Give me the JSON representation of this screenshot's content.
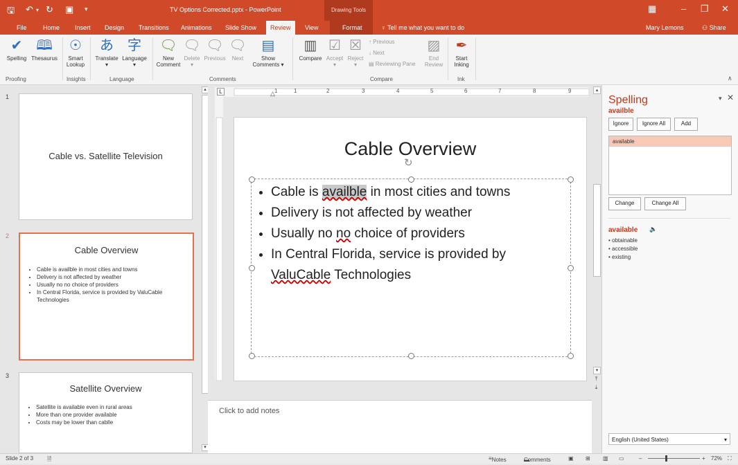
{
  "window": {
    "title": "TV Options Corrected.pptx - PowerPoint",
    "context_tab_group": "Drawing Tools",
    "user": "Mary Lemons",
    "share": "Share"
  },
  "tabs": [
    {
      "label": "File"
    },
    {
      "label": "Home"
    },
    {
      "label": "Insert"
    },
    {
      "label": "Design"
    },
    {
      "label": "Transitions"
    },
    {
      "label": "Animations"
    },
    {
      "label": "Slide Show"
    },
    {
      "label": "Review"
    },
    {
      "label": "View"
    },
    {
      "label": "Format"
    }
  ],
  "tell_me": "Tell me what you want to do",
  "ribbon": {
    "spelling": "Spelling",
    "thesaurus": "Thesaurus",
    "smart_lookup_1": "Smart",
    "smart_lookup_2": "Lookup",
    "translate": "Translate",
    "language": "Language",
    "new_comment_1": "New",
    "new_comment_2": "Comment",
    "delete": "Delete",
    "previous": "Previous",
    "next": "Next",
    "show_comments_1": "Show",
    "show_comments_2": "Comments",
    "compare": "Compare",
    "accept": "Accept",
    "reject": "Reject",
    "prev_change": "Previous",
    "next_change": "Next",
    "reviewing_pane": "Reviewing Pane",
    "end_review_1": "End",
    "end_review_2": "Review",
    "start_inking_1": "Start",
    "start_inking_2": "Inking",
    "groups": {
      "proofing": "Proofing",
      "insights": "Insights",
      "language": "Language",
      "comments": "Comments",
      "compare": "Compare",
      "ink": "Ink"
    }
  },
  "slides": [
    {
      "num": "1",
      "title": "Cable vs. Satellite Television",
      "bullets": []
    },
    {
      "num": "2",
      "title": "Cable Overview",
      "bullets": [
        "Cable is availble in most cities and towns",
        "Delivery is not affected by weather",
        "Usually no no choice of providers",
        "In Central Florida, service is provided by ValuCable Technologies"
      ]
    },
    {
      "num": "3",
      "title": "Satellite Overview",
      "bullets": [
        "Satellite is available even in rural areas",
        "More than one provider available",
        "Costs may be lower than cablle"
      ]
    }
  ],
  "current_slide": {
    "title": "Cable Overview",
    "b1_pre": "Cable is ",
    "b1_err": "availble",
    "b1_post": " in most cities and towns",
    "b2": "Delivery is not affected by weather",
    "b3_pre": "Usually no ",
    "b3_err": "no",
    "b3_post": " choice of providers",
    "b4_pre": "In Central Florida, service is provided by ",
    "b4_err": "ValuCable",
    "b4_post": " Technologies"
  },
  "notes_placeholder": "Click to add notes",
  "ruler_labels": [
    "1",
    "1",
    "2",
    "3",
    "4",
    "5",
    "6",
    "7",
    "8",
    "9"
  ],
  "spelling_pane": {
    "title": "Spelling",
    "misspelled": "availble",
    "ignore": "Ignore",
    "ignore_all": "Ignore All",
    "add": "Add",
    "suggestions": [
      "available"
    ],
    "change": "Change",
    "change_all": "Change All",
    "definition_word": "available",
    "synonyms": [
      "obtainable",
      "accessible",
      "existing"
    ],
    "language": "English (United States)"
  },
  "status": {
    "slide_info": "Slide 2 of 3",
    "notes": "Notes",
    "comments": "Comments",
    "zoom": "72%"
  }
}
